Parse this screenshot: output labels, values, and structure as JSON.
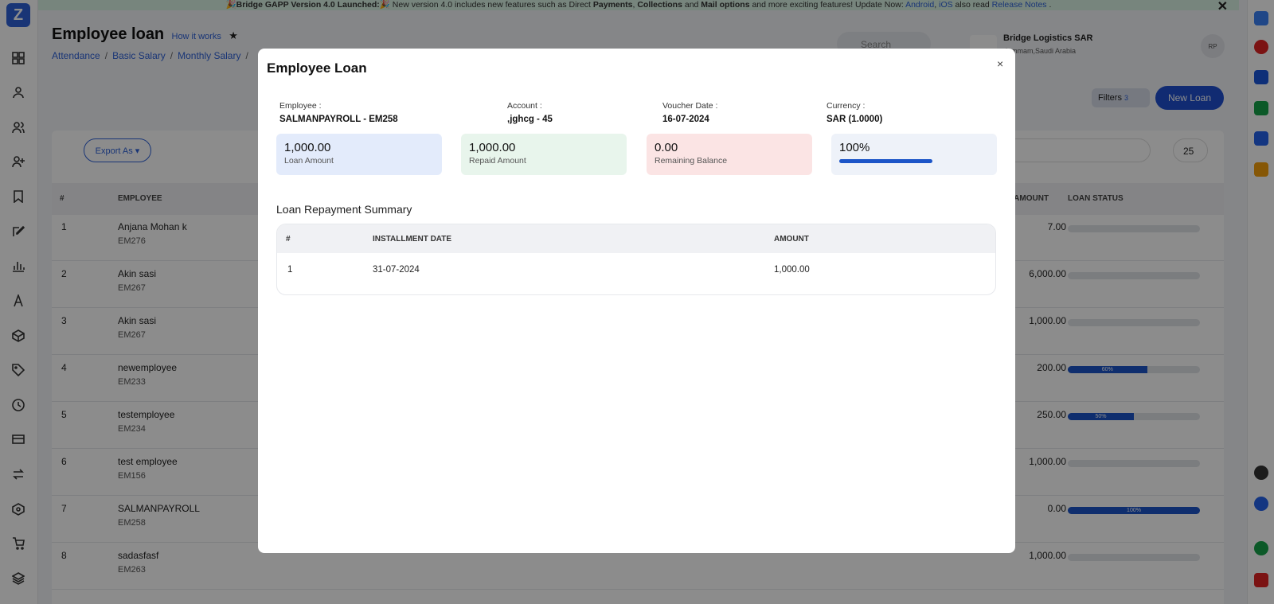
{
  "banner": {
    "prefix": "🎉",
    "title": "Bridge GAPP Version 4.0 Launched:",
    "text": "🎉 New version 4.0 includes new features such as Direct ",
    "b1": "Payments",
    "t2": ", ",
    "b2": "Collections",
    "t3": " and ",
    "b3": "Mail options",
    "t4": " and more exciting features! Update Now: ",
    "link_android": "Android",
    "t5": ", ",
    "link_ios": "iOS",
    "t6": " also read ",
    "link_notes": "Release Notes",
    "t7": " .",
    "close": "✕"
  },
  "header": {
    "title": "Employee loan",
    "how_it_works": "How it works",
    "search_placeholder": "Search",
    "company_name": "Bridge Logistics SAR",
    "company_location": "dammam,Saudi Arabia",
    "avatar_initials": "RP"
  },
  "breadcrumbs": [
    "Attendance",
    "Basic Salary",
    "Monthly Salary"
  ],
  "toolbar": {
    "filters_label": "Filters",
    "filters_count": "3",
    "new_loan_label": "New Loan",
    "export_label": "Export As ▾",
    "page_size": "25"
  },
  "table": {
    "headers": {
      "num": "#",
      "employee": "EMPLOYEE",
      "amount": "G AMOUNT",
      "status": "LOAN STATUS"
    },
    "rows": [
      {
        "n": "1",
        "name": "Anjana Mohan k",
        "code": "EM276",
        "amount": "7.00",
        "progress": 0,
        "progress_label": ""
      },
      {
        "n": "2",
        "name": "Akin sasi",
        "code": "EM267",
        "amount": "6,000.00",
        "progress": 0,
        "progress_label": ""
      },
      {
        "n": "3",
        "name": "Akin sasi",
        "code": "EM267",
        "amount": "1,000.00",
        "progress": 0,
        "progress_label": ""
      },
      {
        "n": "4",
        "name": "newemployee",
        "code": "EM233",
        "amount": "200.00",
        "progress": 60,
        "progress_label": "60%"
      },
      {
        "n": "5",
        "name": "testemployee",
        "code": "EM234",
        "amount": "250.00",
        "progress": 50,
        "progress_label": "50%"
      },
      {
        "n": "6",
        "name": "test employee",
        "code": "EM156",
        "amount": "1,000.00",
        "progress": 0,
        "progress_label": ""
      },
      {
        "n": "7",
        "name": "SALMANPAYROLL",
        "code": "EM258",
        "amount": "0.00",
        "progress": 100,
        "progress_label": "100%"
      },
      {
        "n": "8",
        "name": "sadasfasf",
        "code": "EM263",
        "amount": "1,000.00",
        "progress": 0,
        "progress_label": ""
      }
    ]
  },
  "modal": {
    "title": "Employee Loan",
    "close": "×",
    "employee_label": "Employee :",
    "employee_value": "SALMANPAYROLL - EM258",
    "account_label": "Account :",
    "account_value": ",jghcg - 45",
    "voucher_label": "Voucher Date :",
    "voucher_value": "16-07-2024",
    "currency_label": "Currency :",
    "currency_value": "SAR (1.0000)",
    "loan_amount": "1,000.00",
    "loan_amount_label": "Loan Amount",
    "repaid_amount": "1,000.00",
    "repaid_amount_label": "Repaid Amount",
    "remaining": "0.00",
    "remaining_label": "Remaining Balance",
    "percent": "100%",
    "percent_value": 100,
    "summary_title": "Loan Repayment Summary",
    "summary_headers": {
      "num": "#",
      "date": "INSTALLMENT DATE",
      "amount": "AMOUNT"
    },
    "summary_rows": [
      {
        "n": "1",
        "date": "31-07-2024",
        "amount": "1,000.00"
      }
    ]
  },
  "colors": {
    "primary": "#1f4fcf",
    "loan_bg": "#e3ebfb",
    "repaid_bg": "#e8f5ec",
    "remaining_bg": "#fbe4e4",
    "percent_bg": "#eef2f9"
  }
}
